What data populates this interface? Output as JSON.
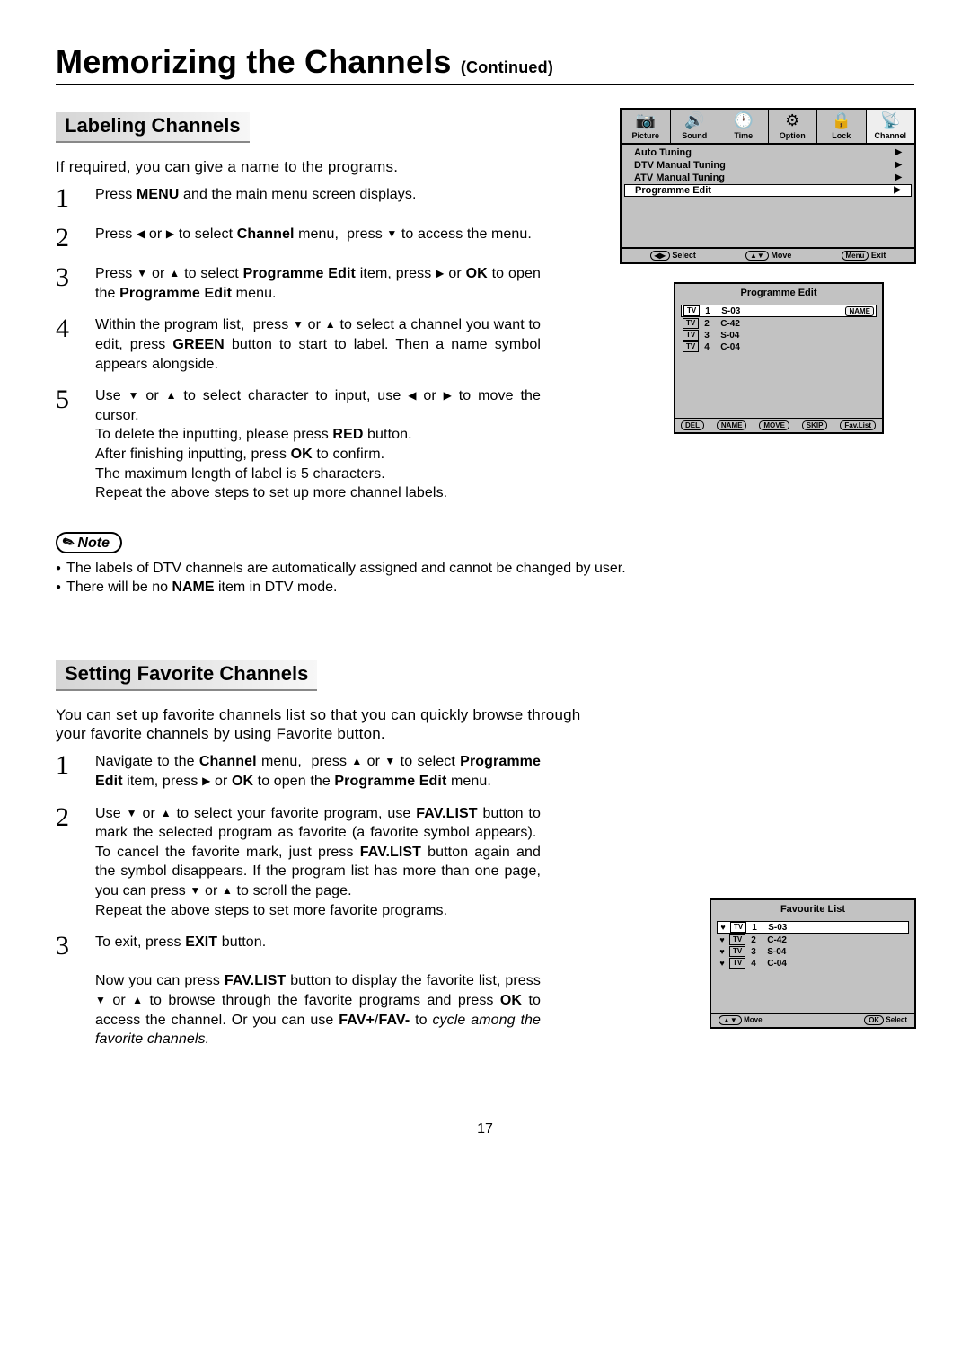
{
  "page": {
    "title": "Memorizing the Channels",
    "continued": "(Continued)",
    "number": "17"
  },
  "labeling": {
    "heading": "Labeling Channels",
    "intro": "If required, you can give a name to the programs.",
    "steps": [
      {
        "n": "1",
        "html": "Press <b>MENU</b> and the main menu screen displays."
      },
      {
        "n": "2",
        "html": "Press <span class='arrow'>◀</span> or <span class='arrow'>▶</span> to select <b>Channel</b> menu,&nbsp; press <span class='arrow'>▼</span> to access the menu."
      },
      {
        "n": "3",
        "html": "Press <span class='arrow'>▼</span> or <span class='arrow'>▲</span> to select <b>Programme Edit</b> item, press <span class='arrow'>▶</span> or <b>OK</b> to open the <b>Programme Edit</b> menu."
      },
      {
        "n": "4",
        "html": "Within the program list,&nbsp; press <span class='arrow'>▼</span> or <span class='arrow'>▲</span> to select a channel you want to edit, press <b>GREEN</b> button to start to label. Then a name symbol appears alongside."
      },
      {
        "n": "5",
        "html": "Use <span class='arrow'>▼</span> or <span class='arrow'>▲</span> to select character to input, use <span class='arrow'>◀</span> or <span class='arrow'>▶</span> to move the cursor.<br>To delete the inputting, please press <b>RED</b> button.<br>After finishing inputting, press <b>OK</b> to confirm.<br>The maximum length of label is 5 characters.<br>Repeat the above steps to set up more channel labels."
      }
    ],
    "note_label": "Note",
    "notes": [
      "The labels of DTV channels are automatically assigned and cannot be changed by user.",
      "There will be no <b>NAME</b> item in DTV mode."
    ]
  },
  "favorite": {
    "heading": "Setting Favorite Channels",
    "intro": "You can set up favorite channels list so that you can quickly browse through your favorite channels by using Favorite button.",
    "steps": [
      {
        "n": "1",
        "html": "Navigate to the <b>Channel</b> menu,&nbsp; press <span class='arrow'>▲</span> or <span class='arrow'>▼</span> to select <b>Programme Edit</b> item, press <span class='arrow'>▶</span> or <b>OK</b> to open the <b>Programme Edit</b> menu."
      },
      {
        "n": "2",
        "html": "Use <span class='arrow'>▼</span> or <span class='arrow'>▲</span> to select your favorite program, use <b>FAV.LIST</b> button to mark the selected program as favorite (a favorite symbol appears).&nbsp; To cancel the favorite mark, just press <b>FAV.LIST</b> button again and the symbol disappears. If the program list has more than one page, you can press <span class='arrow'>▼</span> or <span class='arrow'>▲</span> to scroll the page.<br>Repeat the above steps to set more favorite programs."
      },
      {
        "n": "3",
        "html": "To exit, press <b>EXIT</b> button.<br><br>Now you can press <b>FAV.LIST</b> button to display the favorite list, press <span class='arrow'>▼</span> or <span class='arrow'>▲</span> to browse through the favorite programs and press <b>OK</b> to access the channel. Or you can use <b>FAV+</b>/<b>FAV-</b> to <span class='italic'>cycle among the favorite channels.</span>"
      }
    ]
  },
  "osd_main": {
    "tabs": [
      {
        "icon": "📷",
        "label": "Picture"
      },
      {
        "icon": "🔊",
        "label": "Sound"
      },
      {
        "icon": "🕐",
        "label": "Time"
      },
      {
        "icon": "⚙",
        "label": "Option"
      },
      {
        "icon": "🔒",
        "label": "Lock"
      },
      {
        "icon": "📡",
        "label": "Channel"
      }
    ],
    "rows": [
      {
        "label": "Auto Tuning",
        "sel": false
      },
      {
        "label": "DTV Manual Tuning",
        "sel": false
      },
      {
        "label": "ATV Manual Tuning",
        "sel": false
      },
      {
        "label": "Programme Edit",
        "sel": true
      }
    ],
    "hints": {
      "select_key": "◀▶",
      "select_label": "Select",
      "move_key": "▲▼",
      "move_label": "Move",
      "menu_key": "Menu",
      "menu_label": "Exit"
    }
  },
  "osd_progedit": {
    "title": "Programme Edit",
    "name_btn": "NAME",
    "tv": "TV",
    "channels": [
      {
        "n": "1",
        "name": "S-03",
        "sel": true
      },
      {
        "n": "2",
        "name": "C-42",
        "sel": false
      },
      {
        "n": "3",
        "name": "S-04",
        "sel": false
      },
      {
        "n": "4",
        "name": "C-04",
        "sel": false
      }
    ],
    "buttons": [
      "DEL",
      "NAME",
      "MOVE",
      "SKIP",
      "Fav.List"
    ]
  },
  "osd_fav": {
    "title": "Favourite List",
    "tv": "TV",
    "channels": [
      {
        "n": "1",
        "name": "S-03",
        "sel": true
      },
      {
        "n": "2",
        "name": "C-42",
        "sel": false
      },
      {
        "n": "3",
        "name": "S-04",
        "sel": false
      },
      {
        "n": "4",
        "name": "C-04",
        "sel": false
      }
    ],
    "hints": {
      "move_key": "▲▼",
      "move_label": "Move",
      "ok_key": "OK",
      "ok_label": "Select"
    }
  }
}
